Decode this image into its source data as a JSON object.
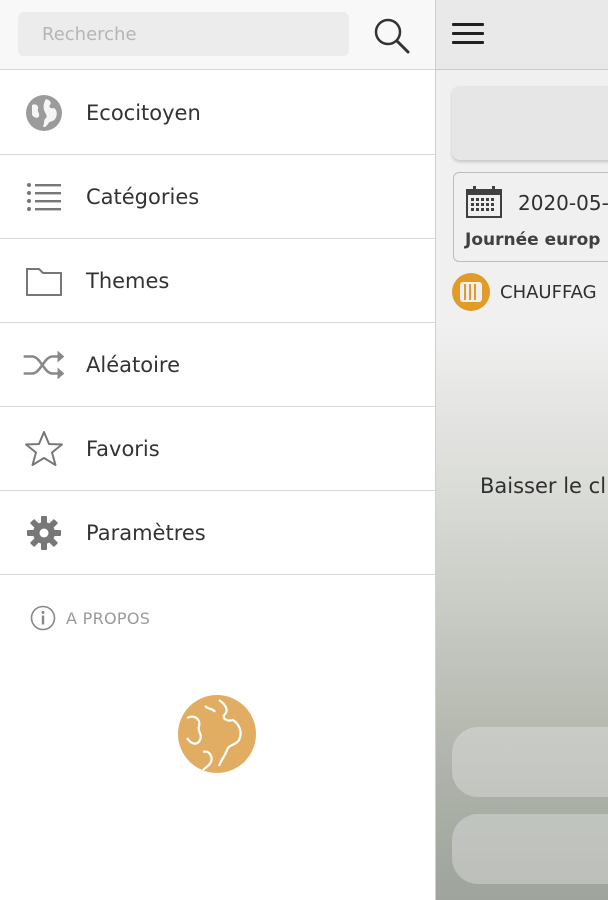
{
  "drawer": {
    "search": {
      "placeholder": "Recherche",
      "value": "",
      "icon": "search-icon"
    },
    "items": [
      {
        "id": "ecocitoyen",
        "label": "Ecocitoyen",
        "icon": "globe-icon"
      },
      {
        "id": "categories",
        "label": "Catégories",
        "icon": "list-icon"
      },
      {
        "id": "themes",
        "label": "Themes",
        "icon": "folder-icon"
      },
      {
        "id": "aleatoire",
        "label": "Aléatoire",
        "icon": "shuffle-icon"
      },
      {
        "id": "favoris",
        "label": "Favoris",
        "icon": "star-icon"
      },
      {
        "id": "parametres",
        "label": "Paramètres",
        "icon": "gear-icon"
      }
    ],
    "about": {
      "label": "A PROPOS",
      "icon": "info-icon"
    },
    "logo": {
      "icon": "globe-logo-icon",
      "color": "#e1ad62"
    }
  },
  "main": {
    "menu_icon": "hamburger-icon",
    "date": "2020-05-",
    "event_title": "Journée europ",
    "category": {
      "label": "CHAUFFAG",
      "color": "#f0a52b",
      "icon": "radiator-icon"
    },
    "tip_text": "Baisser le cl",
    "accent_color": "#2a8fd4"
  }
}
